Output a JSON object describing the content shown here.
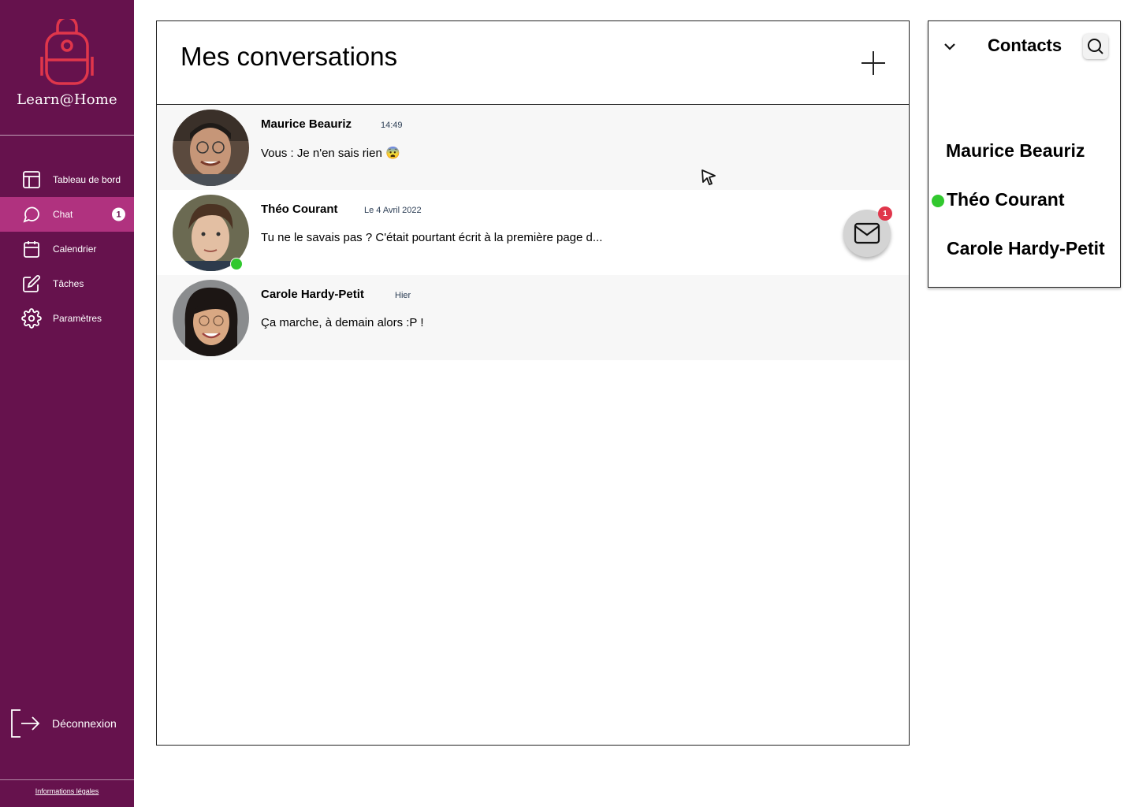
{
  "app": {
    "name": "Learn@Home"
  },
  "sidebar": {
    "items": [
      {
        "label": "Tableau de bord",
        "icon": "layout-icon"
      },
      {
        "label": "Chat",
        "icon": "chat-bubble-icon",
        "badge": "1",
        "active": true
      },
      {
        "label": "Calendrier",
        "icon": "calendar-icon"
      },
      {
        "label": "Tâches",
        "icon": "edit-icon"
      },
      {
        "label": "Paramètres",
        "icon": "gear-icon"
      }
    ],
    "logout_label": "Déconnexion",
    "legal_label": "Informations légales"
  },
  "conversations": {
    "title": "Mes conversations",
    "items": [
      {
        "name": "Maurice Beauriz",
        "time": "14:49",
        "message": "Vous : Je n'en sais rien 😨",
        "online": false
      },
      {
        "name": "Théo Courant",
        "time": "Le 4 Avril 2022",
        "message": "Tu ne le savais pas ? C'était pourtant écrit à la première page d...",
        "online": true
      },
      {
        "name": "Carole Hardy-Petit",
        "time": "Hier",
        "message": "Ça marche, à demain alors :P !",
        "online": false
      }
    ],
    "mail_badge": "1"
  },
  "contacts": {
    "title": "Contacts",
    "items": [
      {
        "name": "Maurice Beauriz",
        "online": false
      },
      {
        "name": "Théo Courant",
        "online": true
      },
      {
        "name": "Carole Hardy-Petit",
        "online": false
      }
    ]
  },
  "colors": {
    "sidebar": "#66124d",
    "sidebar_active": "#b0327f",
    "logo": "#e0364b",
    "online": "#31c82e",
    "badge": "#e0364b"
  }
}
